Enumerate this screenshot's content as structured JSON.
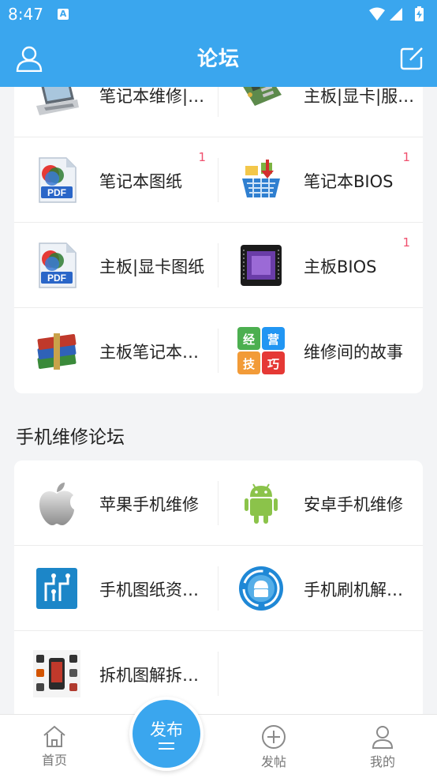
{
  "status_bar": {
    "time": "8:47",
    "notification_icon": "A"
  },
  "header": {
    "title": "论坛"
  },
  "card1": {
    "rows": [
      {
        "left": {
          "label": "笔记本维修|…",
          "icon": "laptop-icon",
          "badge": ""
        },
        "right": {
          "label": "主板|显卡|服…",
          "icon": "motherboard-icon",
          "badge": ""
        }
      },
      {
        "left": {
          "label": "笔记本图纸",
          "icon": "pdf-icon",
          "badge": "1"
        },
        "right": {
          "label": "笔记本BIOS",
          "icon": "download-basket-icon",
          "badge": "1"
        }
      },
      {
        "left": {
          "label": "主板|显卡图纸",
          "icon": "pdf-icon",
          "badge": ""
        },
        "right": {
          "label": "主板BIOS",
          "icon": "chip-icon",
          "badge": "1"
        }
      },
      {
        "left": {
          "label": "主板笔记本…",
          "icon": "winrar-books-icon",
          "badge": ""
        },
        "right": {
          "label": "维修间的故事",
          "icon": "tips-tiles-icon",
          "badge": "",
          "tiles": [
            "经",
            "营",
            "技",
            "巧"
          ]
        }
      }
    ]
  },
  "section2": {
    "title": "手机维修论坛"
  },
  "card2": {
    "rows": [
      {
        "left": {
          "label": "苹果手机维修",
          "icon": "apple-logo-icon"
        },
        "right": {
          "label": "安卓手机维修",
          "icon": "android-robot-icon"
        }
      },
      {
        "left": {
          "label": "手机图纸资…",
          "icon": "circuit-schematic-icon"
        },
        "right": {
          "label": "手机刷机解…",
          "icon": "android-flash-icon"
        }
      },
      {
        "left": {
          "label": "拆机图解拆…",
          "icon": "phone-teardown-icon"
        }
      }
    ]
  },
  "bottom_nav": {
    "home": "首页",
    "publish": "发布",
    "post": "发帖",
    "mine": "我的"
  },
  "colors": {
    "primary": "#3aa6ee",
    "badge": "#f0506e",
    "background": "#f3f4f6"
  }
}
